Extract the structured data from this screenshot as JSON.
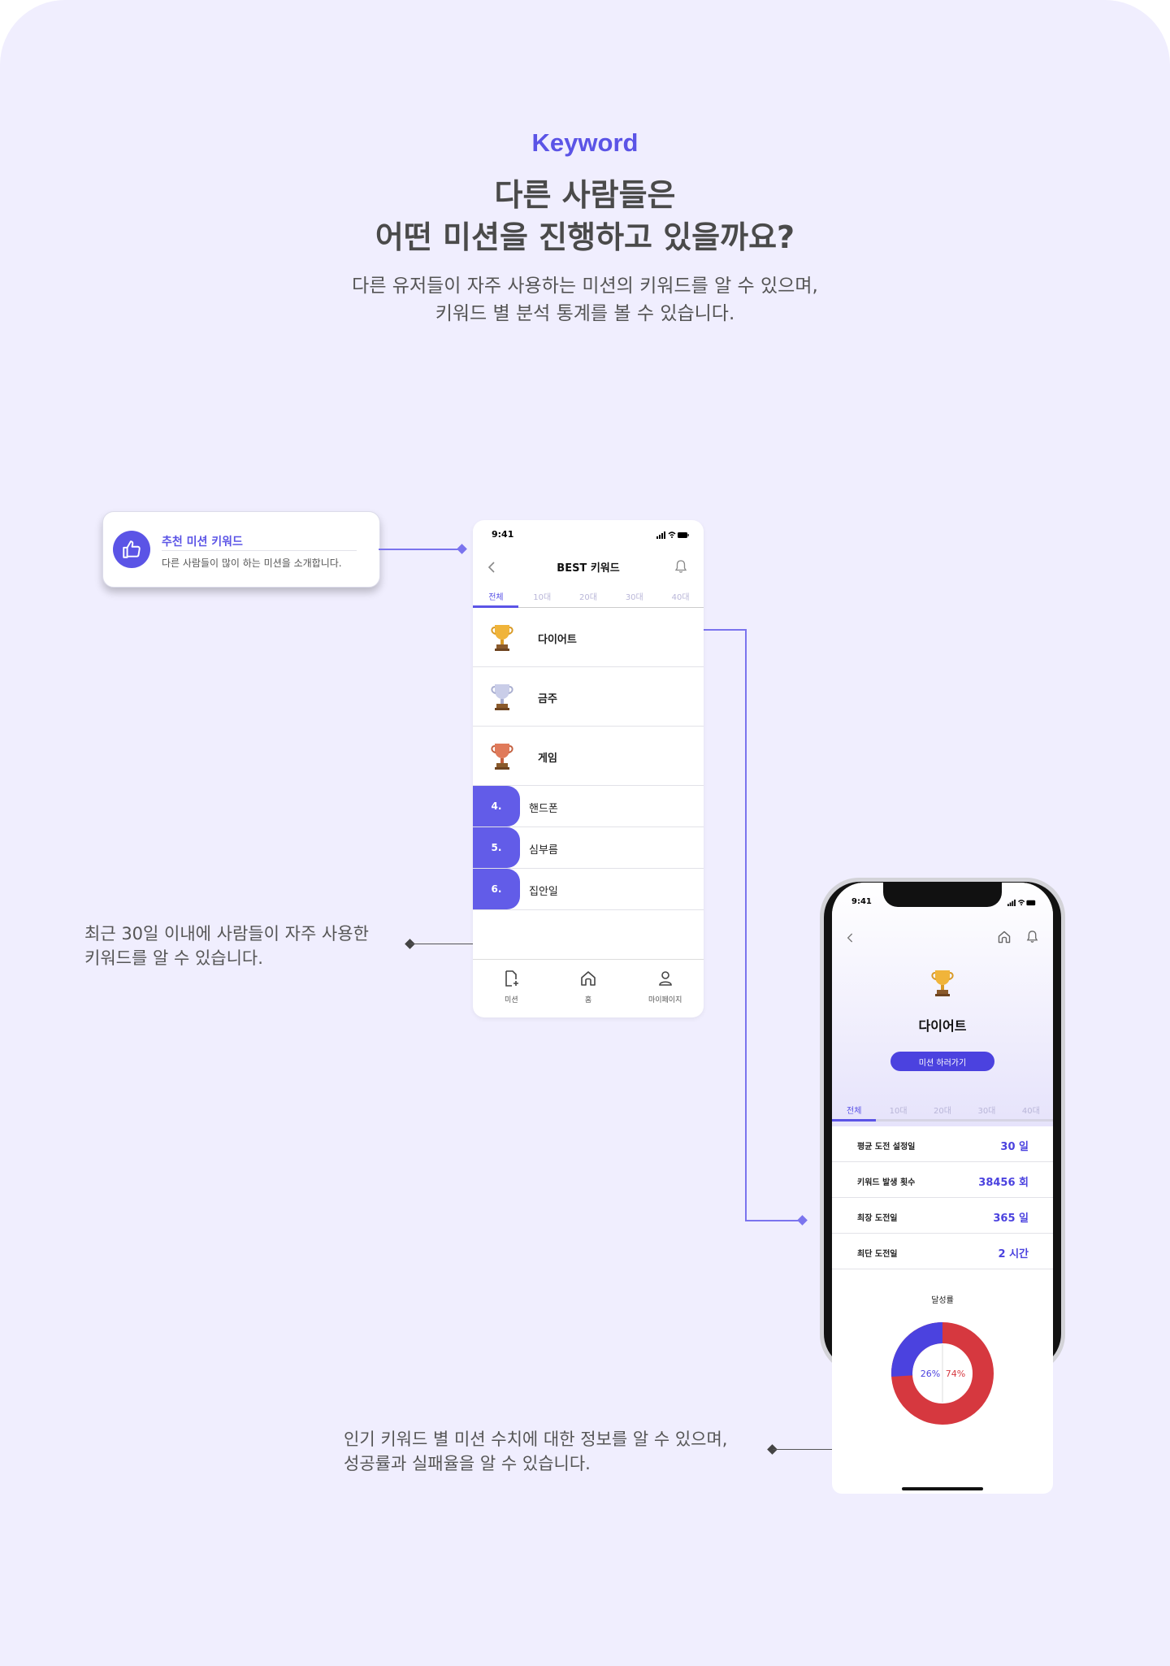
{
  "intro": {
    "section_label": "Keyword",
    "headline_line1": "다른 사람들은",
    "headline_line2": "어떤 미션을 진행하고 있을까요?",
    "desc_line1": "다른 유저들이 자주 사용하는 미션의 키워드를 알 수 있으며,",
    "desc_line2": "키워드 별 분석 통계를 볼 수 있습니다."
  },
  "recommend_card": {
    "icon": "thumbs-up-icon",
    "title": "추천 미션 키워드",
    "desc": "다른 사람들이 많이 하는 미션을 소개합니다."
  },
  "annotations": {
    "left_line1": "최근 30일 이내에 사람들이 자주 사용한",
    "left_line2": "키워드를 알 수 있습니다.",
    "bottom_line1": "인기 키워드 별 미션 수치에 대한 정보를 알 수 있으며,",
    "bottom_line2": "성공률과 실패율을 알 수 있습니다."
  },
  "phone1": {
    "time": "9:41",
    "title": "BEST 키워드",
    "tabs": [
      "전체",
      "10대",
      "20대",
      "30대",
      "40대"
    ],
    "active_tab": 0,
    "top_ranks": [
      {
        "rank": 1,
        "label": "다이어트",
        "trophy": "gold-trophy-icon"
      },
      {
        "rank": 2,
        "label": "금주",
        "trophy": "silver-trophy-icon"
      },
      {
        "rank": 3,
        "label": "게임",
        "trophy": "bronze-trophy-icon"
      }
    ],
    "other_ranks": [
      {
        "num": "4.",
        "label": "핸드폰"
      },
      {
        "num": "5.",
        "label": "심부름"
      },
      {
        "num": "6.",
        "label": "집안일"
      }
    ],
    "nav": [
      {
        "icon": "mission-doc-icon",
        "label": "미션"
      },
      {
        "icon": "home-icon",
        "label": "홈"
      },
      {
        "icon": "user-icon",
        "label": "마이페이지"
      }
    ]
  },
  "phone2": {
    "time": "9:41",
    "keyword": "다이어트",
    "cta": "미션 하러가기",
    "tabs": [
      "전체",
      "10대",
      "20대",
      "30대",
      "40대"
    ],
    "active_tab": 0,
    "stats": [
      {
        "key": "평균 도전 설정일",
        "value": "30 일"
      },
      {
        "key": "키워드 발생 횟수",
        "value": "38456 회"
      },
      {
        "key": "최장 도전일",
        "value": "365 일"
      },
      {
        "key": "최단 도전일",
        "value": "2 시간"
      }
    ],
    "rate_label": "달성률",
    "success_pct": 26,
    "fail_pct": 74,
    "success_text": "26%",
    "fail_text": "74%",
    "colors": {
      "success": "#4b42df",
      "fail": "#d6383f"
    }
  },
  "colors": {
    "accent": "#5b54e6",
    "background": "#f0eefe"
  }
}
